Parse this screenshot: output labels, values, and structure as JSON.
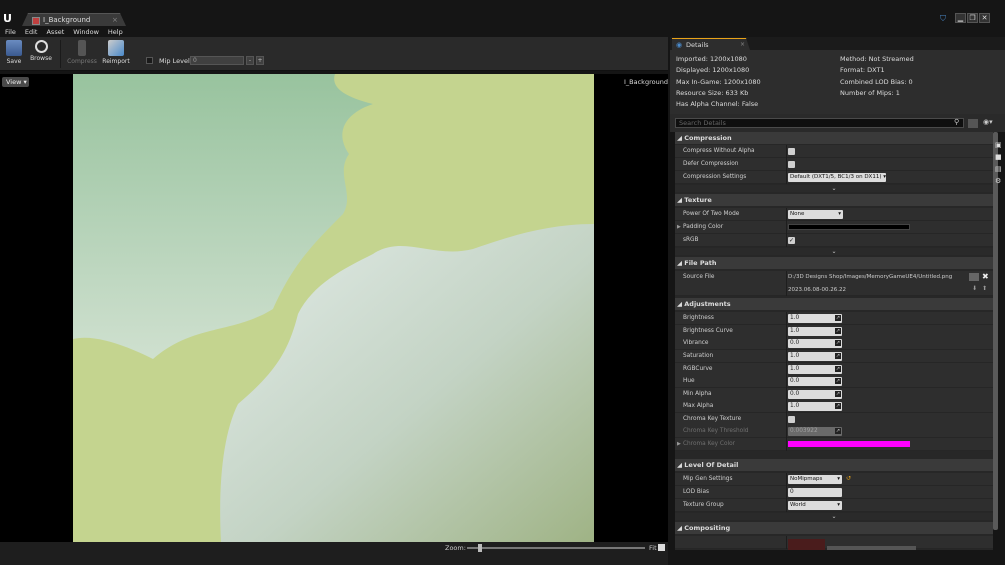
{
  "window": {
    "tab_title": "I_Background",
    "close_glyph": "×",
    "controls": [
      "▁",
      "❐",
      "✕"
    ]
  },
  "menu": [
    "File",
    "Edit",
    "Asset",
    "Window",
    "Help"
  ],
  "toolbar": {
    "save": "Save",
    "browse": "Browse",
    "compress": "Compress",
    "reimport": "Reimport",
    "mip_label": "Mip Level",
    "mip_value": "0",
    "spin_minus": "-",
    "spin_plus": "+"
  },
  "viewport": {
    "view_button": "View ▾",
    "texture_name": "I_Background",
    "zoom_label": "Zoom:",
    "fit_label": "Fit"
  },
  "details": {
    "tab_label": "Details",
    "info_left": [
      "Imported: 1200x1080",
      "Displayed: 1200x1080",
      "Max In-Game: 1200x1080",
      "Resource Size: 633 Kb",
      "Has Alpha Channel: False"
    ],
    "info_right": [
      "Method: Not Streamed",
      "Format: DXT1",
      "Combined LOD Bias: 0",
      "Number of Mips: 1"
    ],
    "search_placeholder": "Search Details",
    "categories": {
      "compression": "Compression",
      "texture": "Texture",
      "file_path": "File Path",
      "adjustments": "Adjustments",
      "lod": "Level Of Detail",
      "compositing": "Compositing"
    },
    "compression": {
      "compress_without_alpha": "Compress Without Alpha",
      "defer_compression": "Defer Compression",
      "compression_settings": "Compression Settings",
      "compression_settings_value": "Default (DXT1/5, BC1/3 on DX11) ▾"
    },
    "texture": {
      "power_of_two": "Power Of Two Mode",
      "power_of_two_value": "None",
      "padding_color": "Padding Color",
      "srgb": "sRGB",
      "srgb_check": "✓"
    },
    "file_path": {
      "source_file": "Source File",
      "path": "D:/3D Designs Shop/Images/MemoryGameUE4/Untitled.png",
      "timestamp": "2023.06.08-00.26.22"
    },
    "adjustments": [
      {
        "name": "Brightness",
        "value": "1.0"
      },
      {
        "name": "Brightness Curve",
        "value": "1.0"
      },
      {
        "name": "Vibrance",
        "value": "0.0"
      },
      {
        "name": "Saturation",
        "value": "1.0"
      },
      {
        "name": "RGBCurve",
        "value": "1.0"
      },
      {
        "name": "Hue",
        "value": "0.0"
      },
      {
        "name": "Min Alpha",
        "value": "0.0"
      },
      {
        "name": "Max Alpha",
        "value": "1.0"
      }
    ],
    "chroma": {
      "key_texture": "Chroma Key Texture",
      "threshold": "Chroma Key Threshold",
      "threshold_value": "0.003922",
      "key_color": "Chroma Key Color"
    },
    "lod": {
      "mip_gen": "Mip Gen Settings",
      "mip_gen_value": "NoMipmaps",
      "lod_bias": "LOD Bias",
      "lod_bias_value": "0",
      "texture_group": "Texture Group",
      "texture_group_value": "World"
    }
  },
  "colors": {
    "accent_tab": "#e8a319",
    "chroma_key": "#ff00ff",
    "padding": "#000000",
    "texture_green": "#c5d591",
    "texture_light": "#d2e2d8"
  }
}
